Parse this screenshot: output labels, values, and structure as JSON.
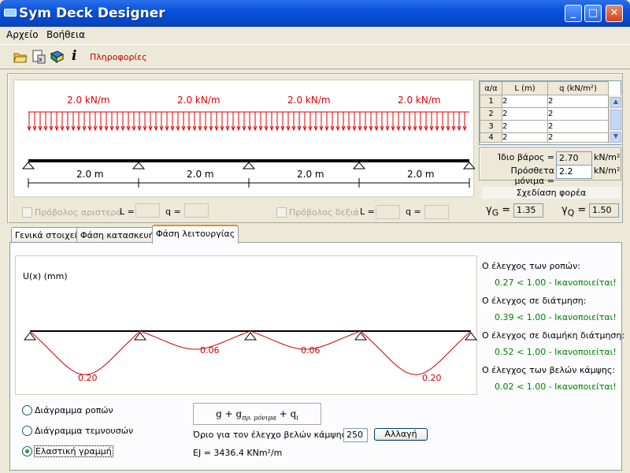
{
  "window": {
    "title": "Sym Deck Designer"
  },
  "menu": [
    "Αρχείο",
    "Βοήθεια"
  ],
  "toolbar": {
    "icons": [
      "open-folder-icon",
      "export-icon",
      "book-icon",
      "info-icon"
    ],
    "info_label": "Πληροφορίες"
  },
  "beam": {
    "loads": [
      "2.0 kN/m",
      "2.0 kN/m",
      "2.0 kN/m",
      "2.0 kN/m"
    ],
    "spans": [
      "2.0 m",
      "2.0 m",
      "2.0 m",
      "2.0 m"
    ]
  },
  "span_table": {
    "headers": [
      "α/α",
      "L (m)",
      "q (kN/m²)"
    ],
    "rows": [
      [
        "1",
        "2",
        "2"
      ],
      [
        "2",
        "2",
        "2"
      ],
      [
        "3",
        "2",
        "2"
      ],
      [
        "4",
        "2",
        "2"
      ]
    ]
  },
  "weights": {
    "self_label": "Ίδιο βάρος =",
    "self_value": "2.70",
    "self_unit": "kN/m²",
    "extra_label": "Πρόσθετα μόνιμα =",
    "extra_value": "2.2",
    "extra_unit": "kN/m²"
  },
  "design_button": "Σχεδίαση φορέα",
  "gamma": {
    "g_sym": "γ",
    "g_sub": "G",
    "g_eq": "=",
    "g_value": "1.35",
    "q_sym": "γ",
    "q_sub": "Q",
    "q_eq": "=",
    "q_value": "1.50"
  },
  "cantilever": {
    "left_label": "Πρόβολος αριστερά",
    "right_label": "Πρόβολος δεξιά",
    "L_label": "L =",
    "q_label": "q ="
  },
  "tabs": [
    "Γενικά στοιχεία",
    "Φάση κατασκευής",
    "Φάση λειτουργίας"
  ],
  "deflection": {
    "ylabel": "U(x) (mm)",
    "labels": [
      "0.20",
      "0.06",
      "0.06",
      "0.20"
    ]
  },
  "checks": [
    {
      "title": "Ο έλεγχος των ροπών:",
      "result": "0.27 < 1.00 - Ικανοποιείται!"
    },
    {
      "title": "Ο έλεγχος σε διάτμηση:",
      "result": "0.39 < 1.00 - Ικανοποιείται!"
    },
    {
      "title": "Ο έλεγχος σε διαμήκη διάτμηση:",
      "result": "0.52 < 1.00 - Ικανοποιείται!"
    },
    {
      "title": "Ο έλεγχος των βελών κάμψης:",
      "result": "0.02 < 1.00 - Ικανοποιείται!"
    }
  ],
  "diagrams": [
    "Διάγραμμα ροπών",
    "Διάγραμμα τεμνουσών",
    "Ελαστική γραμμή"
  ],
  "selected_diagram": 2,
  "formula": {
    "g": "g",
    "plus1": "+",
    "gsub": "g",
    "sub": "πρ. μόνιμα",
    "plus2": "+",
    "q": "q",
    "qsub": "i"
  },
  "deflection_limit": {
    "label": "Όριο για τον έλεγχο βελών κάμψης: L /",
    "value": "250",
    "button": "Αλλαγή"
  },
  "ej": "EJ = 3436.4 KNm²/m"
}
